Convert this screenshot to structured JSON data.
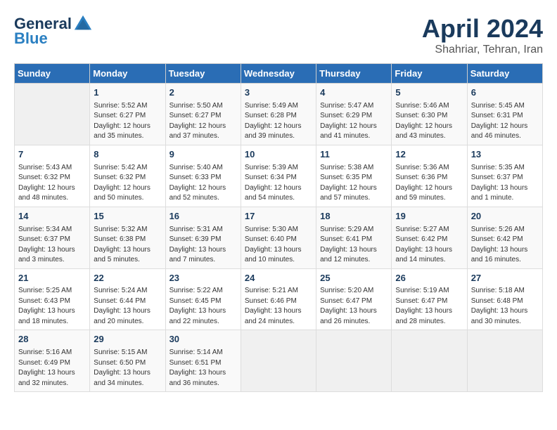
{
  "header": {
    "logo_general": "General",
    "logo_blue": "Blue",
    "title": "April 2024",
    "location": "Shahriar, Tehran, Iran"
  },
  "calendar": {
    "days_of_week": [
      "Sunday",
      "Monday",
      "Tuesday",
      "Wednesday",
      "Thursday",
      "Friday",
      "Saturday"
    ],
    "weeks": [
      [
        {
          "day": "",
          "info": ""
        },
        {
          "day": "1",
          "info": "Sunrise: 5:52 AM\nSunset: 6:27 PM\nDaylight: 12 hours\nand 35 minutes."
        },
        {
          "day": "2",
          "info": "Sunrise: 5:50 AM\nSunset: 6:27 PM\nDaylight: 12 hours\nand 37 minutes."
        },
        {
          "day": "3",
          "info": "Sunrise: 5:49 AM\nSunset: 6:28 PM\nDaylight: 12 hours\nand 39 minutes."
        },
        {
          "day": "4",
          "info": "Sunrise: 5:47 AM\nSunset: 6:29 PM\nDaylight: 12 hours\nand 41 minutes."
        },
        {
          "day": "5",
          "info": "Sunrise: 5:46 AM\nSunset: 6:30 PM\nDaylight: 12 hours\nand 43 minutes."
        },
        {
          "day": "6",
          "info": "Sunrise: 5:45 AM\nSunset: 6:31 PM\nDaylight: 12 hours\nand 46 minutes."
        }
      ],
      [
        {
          "day": "7",
          "info": "Sunrise: 5:43 AM\nSunset: 6:32 PM\nDaylight: 12 hours\nand 48 minutes."
        },
        {
          "day": "8",
          "info": "Sunrise: 5:42 AM\nSunset: 6:32 PM\nDaylight: 12 hours\nand 50 minutes."
        },
        {
          "day": "9",
          "info": "Sunrise: 5:40 AM\nSunset: 6:33 PM\nDaylight: 12 hours\nand 52 minutes."
        },
        {
          "day": "10",
          "info": "Sunrise: 5:39 AM\nSunset: 6:34 PM\nDaylight: 12 hours\nand 54 minutes."
        },
        {
          "day": "11",
          "info": "Sunrise: 5:38 AM\nSunset: 6:35 PM\nDaylight: 12 hours\nand 57 minutes."
        },
        {
          "day": "12",
          "info": "Sunrise: 5:36 AM\nSunset: 6:36 PM\nDaylight: 12 hours\nand 59 minutes."
        },
        {
          "day": "13",
          "info": "Sunrise: 5:35 AM\nSunset: 6:37 PM\nDaylight: 13 hours\nand 1 minute."
        }
      ],
      [
        {
          "day": "14",
          "info": "Sunrise: 5:34 AM\nSunset: 6:37 PM\nDaylight: 13 hours\nand 3 minutes."
        },
        {
          "day": "15",
          "info": "Sunrise: 5:32 AM\nSunset: 6:38 PM\nDaylight: 13 hours\nand 5 minutes."
        },
        {
          "day": "16",
          "info": "Sunrise: 5:31 AM\nSunset: 6:39 PM\nDaylight: 13 hours\nand 7 minutes."
        },
        {
          "day": "17",
          "info": "Sunrise: 5:30 AM\nSunset: 6:40 PM\nDaylight: 13 hours\nand 10 minutes."
        },
        {
          "day": "18",
          "info": "Sunrise: 5:29 AM\nSunset: 6:41 PM\nDaylight: 13 hours\nand 12 minutes."
        },
        {
          "day": "19",
          "info": "Sunrise: 5:27 AM\nSunset: 6:42 PM\nDaylight: 13 hours\nand 14 minutes."
        },
        {
          "day": "20",
          "info": "Sunrise: 5:26 AM\nSunset: 6:42 PM\nDaylight: 13 hours\nand 16 minutes."
        }
      ],
      [
        {
          "day": "21",
          "info": "Sunrise: 5:25 AM\nSunset: 6:43 PM\nDaylight: 13 hours\nand 18 minutes."
        },
        {
          "day": "22",
          "info": "Sunrise: 5:24 AM\nSunset: 6:44 PM\nDaylight: 13 hours\nand 20 minutes."
        },
        {
          "day": "23",
          "info": "Sunrise: 5:22 AM\nSunset: 6:45 PM\nDaylight: 13 hours\nand 22 minutes."
        },
        {
          "day": "24",
          "info": "Sunrise: 5:21 AM\nSunset: 6:46 PM\nDaylight: 13 hours\nand 24 minutes."
        },
        {
          "day": "25",
          "info": "Sunrise: 5:20 AM\nSunset: 6:47 PM\nDaylight: 13 hours\nand 26 minutes."
        },
        {
          "day": "26",
          "info": "Sunrise: 5:19 AM\nSunset: 6:47 PM\nDaylight: 13 hours\nand 28 minutes."
        },
        {
          "day": "27",
          "info": "Sunrise: 5:18 AM\nSunset: 6:48 PM\nDaylight: 13 hours\nand 30 minutes."
        }
      ],
      [
        {
          "day": "28",
          "info": "Sunrise: 5:16 AM\nSunset: 6:49 PM\nDaylight: 13 hours\nand 32 minutes."
        },
        {
          "day": "29",
          "info": "Sunrise: 5:15 AM\nSunset: 6:50 PM\nDaylight: 13 hours\nand 34 minutes."
        },
        {
          "day": "30",
          "info": "Sunrise: 5:14 AM\nSunset: 6:51 PM\nDaylight: 13 hours\nand 36 minutes."
        },
        {
          "day": "",
          "info": ""
        },
        {
          "day": "",
          "info": ""
        },
        {
          "day": "",
          "info": ""
        },
        {
          "day": "",
          "info": ""
        }
      ]
    ]
  }
}
